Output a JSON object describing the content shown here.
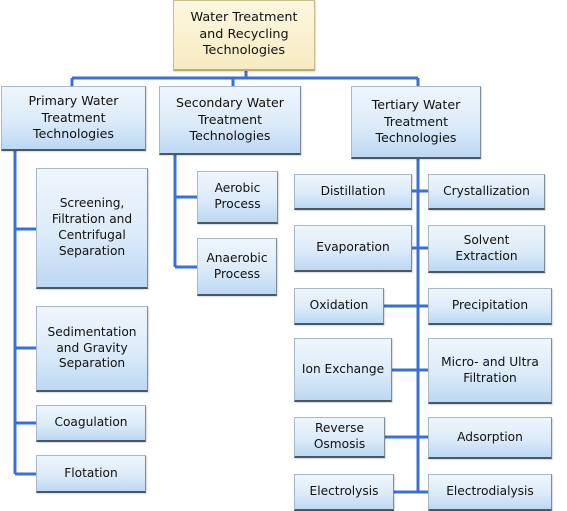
{
  "root": {
    "label": "Water Treatment and Recycling Technologies"
  },
  "categories": {
    "primary": {
      "label": "Primary Water Treatment Technologies",
      "children": [
        "Screening, Filtration and Centrifugal Separation",
        "Sedimentation and Gravity Separation",
        "Coagulation",
        "Flotation"
      ]
    },
    "secondary": {
      "label": "Secondary Water Treatment Technologies",
      "children": [
        "Aerobic Process",
        "Anaerobic Process"
      ]
    },
    "tertiary": {
      "label": "Tertiary Water Treatment Technologies",
      "left": [
        "Distillation",
        "Evaporation",
        "Oxidation",
        "Ion Exchange",
        "Reverse Osmosis",
        "Electrolysis"
      ],
      "right": [
        "Crystallization",
        "Solvent Extraction",
        "Precipitation",
        "Micro- and Ultra Filtration",
        "Adsorption",
        "Electrodialysis"
      ]
    }
  },
  "colors": {
    "connector": "#3a6fd8",
    "box_fill": "#dcebf9",
    "root_fill": "#f7ebc2"
  }
}
